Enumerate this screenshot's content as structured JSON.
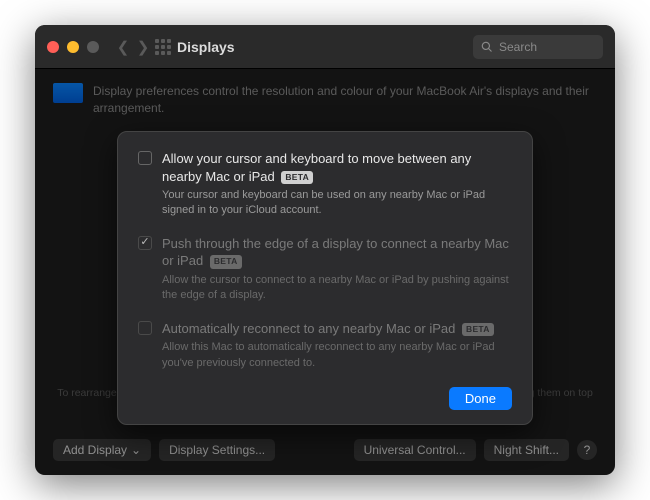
{
  "window": {
    "title": "Displays",
    "search_placeholder": "Search"
  },
  "header": {
    "description": "Display preferences control the resolution and colour of your MacBook Air's displays and their arrangement."
  },
  "sheet": {
    "options": [
      {
        "title": "Allow your cursor and keyboard to move between any nearby Mac or iPad",
        "badge": "BETA",
        "desc": "Your cursor and keyboard can be used on any nearby Mac or iPad signed in to your iCloud account."
      },
      {
        "title": "Push through the edge of a display to connect a nearby Mac or iPad",
        "badge": "BETA",
        "desc": "Allow the cursor to connect to a nearby Mac or iPad by pushing against the edge of a display."
      },
      {
        "title": "Automatically reconnect to any nearby Mac or iPad",
        "badge": "BETA",
        "desc": "Allow this Mac to automatically reconnect to any nearby Mac or iPad you've previously connected to."
      }
    ],
    "done": "Done"
  },
  "hint": "To rearrange displays, drag them to the desired position. To mirror displays, hold Option while dragging them on top of each other. To relocate the menu bar, drag it to a different display.",
  "buttons": {
    "add_display": "Add Display",
    "display_settings": "Display Settings...",
    "universal_control": "Universal Control...",
    "night_shift": "Night Shift...",
    "help": "?"
  }
}
